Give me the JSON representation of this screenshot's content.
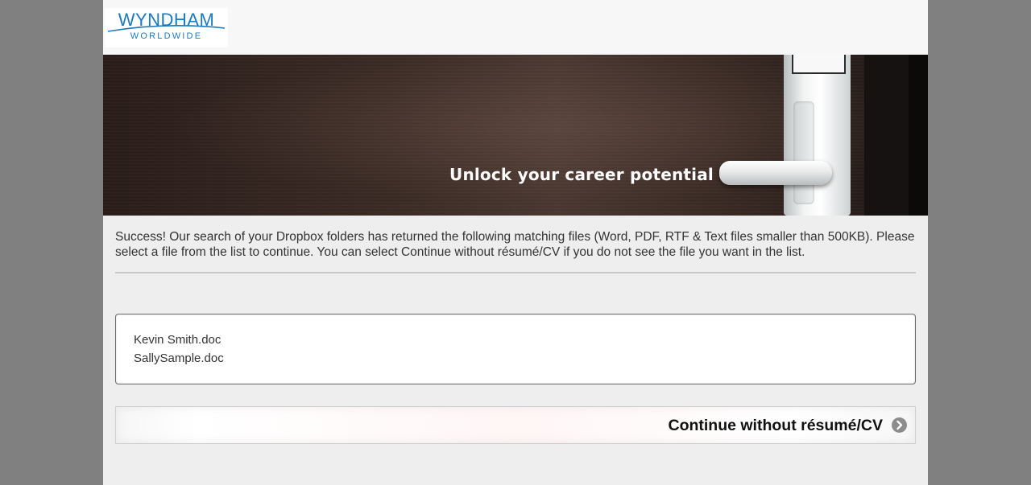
{
  "header": {
    "logo": {
      "name": "WYNDHAM",
      "subtitle": "WORLDWIDE"
    }
  },
  "banner": {
    "tagline": "Unlock your career potential"
  },
  "message": "Success! Our search of your Dropbox folders has returned the following matching files (Word, PDF, RTF & Text files smaller than 500KB). Please select a file from the list to continue. You can select Continue without résumé/CV if you do not see the file you want in the list.",
  "files": [
    "Kevin Smith.doc",
    "SallySample.doc"
  ],
  "continue_button": {
    "label": "Continue without résumé/CV",
    "icon": "chevron-right-circle-icon"
  },
  "colors": {
    "brand_blue": "#1b7bbd",
    "page_background": "#eeeeee",
    "outer_background": "#808080"
  }
}
